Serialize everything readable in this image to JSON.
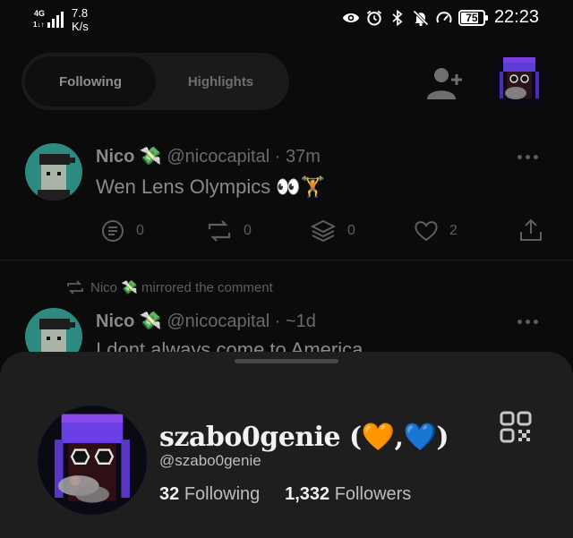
{
  "status_bar": {
    "network": "4G",
    "network_sub": "1",
    "speed_value": "7.8",
    "speed_unit": "K/s",
    "battery": "75",
    "time": "22:23",
    "icons": [
      "eye-icon",
      "alarm-icon",
      "bluetooth-icon",
      "bell-off-icon",
      "speedometer-icon"
    ]
  },
  "header": {
    "tabs": [
      {
        "label": "Following",
        "active": true
      },
      {
        "label": "Highlights",
        "active": false
      }
    ],
    "add_user_icon": "person-add-icon"
  },
  "feed": {
    "posts": [
      {
        "author": "Nico",
        "emoji": "💸",
        "handle": "@nicocapital",
        "time": "· 37m",
        "text": "Wen Lens Olympics 👀🏋️",
        "stats": {
          "comments": "0",
          "mirrors": "0",
          "collects": "0",
          "likes": "2"
        }
      },
      {
        "repost_label": "Nico 💸 mirrored the comment",
        "author": "Nico",
        "emoji": "💸",
        "handle": "@nicocapital",
        "time": "· ~1d",
        "text": "I dont always come to America"
      }
    ]
  },
  "profile_sheet": {
    "display_name": "szabo0genie (🧡,💙)",
    "handle": "@szabo0genie",
    "following_count": "32",
    "following_label": "Following",
    "followers_count": "1,332",
    "followers_label": "Followers"
  }
}
